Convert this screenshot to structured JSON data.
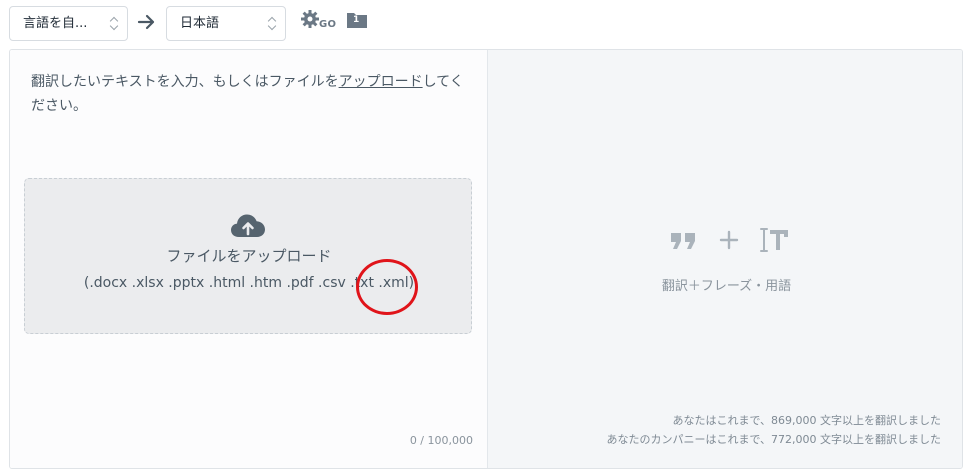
{
  "toolbar": {
    "source_language": "言語を自...",
    "target_language": "日本語",
    "glossary_go_label": "GO",
    "folder_count": "1"
  },
  "left_pane": {
    "prompt_text": "翻訳したいテキストを入力、もしくはファイルを",
    "prompt_link": "アップロード",
    "prompt_suffix": "してください。",
    "dropzone": {
      "title": "ファイルをアップロード",
      "extensions": "(.docx .xlsx .pptx .html .htm .pdf .csv .txt .xml)"
    },
    "char_count": "0 / 100,000"
  },
  "right_pane": {
    "caption": "翻訳＋フレーズ・用語",
    "stats": [
      "あなたはこれまで、869,000 文字以上を翻訳しました",
      "あなたのカンパニーはこれまで、772,000 文字以上を翻訳しました"
    ]
  },
  "colors": {
    "annotation": "#e0141a",
    "icon_gray": "#6b7885",
    "light_icon": "#aab3bb"
  }
}
